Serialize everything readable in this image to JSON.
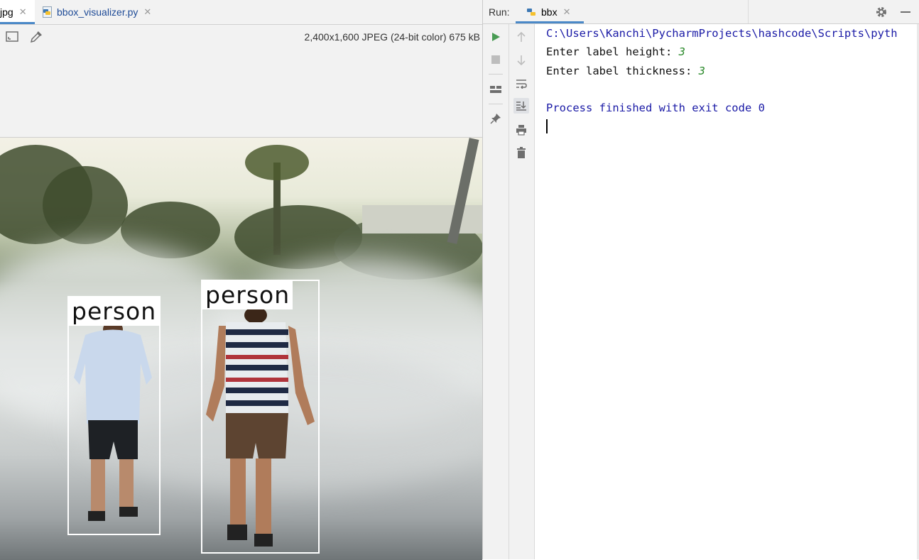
{
  "editor": {
    "tabs": [
      {
        "label": "jpg",
        "active": true
      },
      {
        "label": "bbox_visualizer.py",
        "active": false
      }
    ],
    "image_info": "2,400x1,600 JPEG (24-bit color) 675 kB",
    "detections": [
      {
        "label": "person"
      },
      {
        "label": "person"
      }
    ]
  },
  "run_panel": {
    "title": "Run:",
    "tab_label": "bbx",
    "console": {
      "path_line": "C:\\Users\\Kanchi\\PycharmProjects\\hashcode\\Scripts\\pyth",
      "prompt1": "Enter label height: ",
      "input1": "3",
      "prompt2": "Enter label thickness: ",
      "input2": "3",
      "finish": "Process finished with exit code 0"
    }
  },
  "colors": {
    "accent": "#4a88c7",
    "console_blue": "#1a1aa6",
    "input_green": "#2b8a2b",
    "run_green": "#499c54"
  },
  "icons": [
    "fit-image-icon",
    "color-picker-icon",
    "python-file-icon",
    "run-icon",
    "stop-icon",
    "layout-icon",
    "pin-icon",
    "up-arrow-icon",
    "down-arrow-icon",
    "soft-wrap-icon",
    "scroll-to-end-icon",
    "print-icon",
    "trash-icon",
    "settings-icon",
    "minimize-icon"
  ]
}
